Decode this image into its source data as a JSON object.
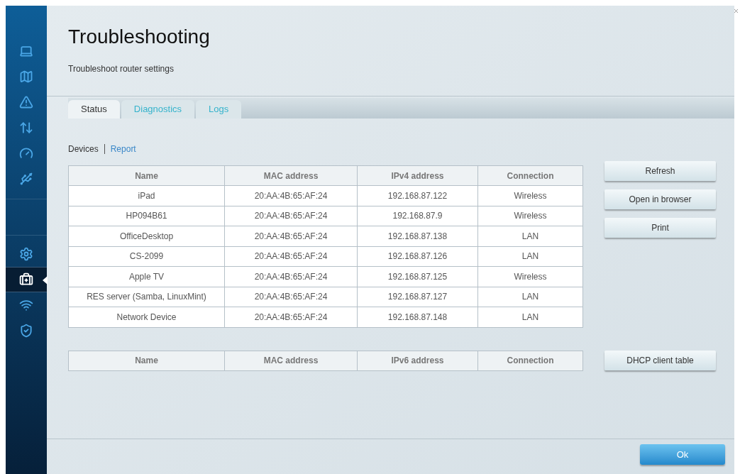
{
  "sidebar": {
    "apps": [
      {
        "selected": false
      },
      {
        "selected": false
      },
      {
        "selected": false
      },
      {
        "selected": false
      },
      {
        "selected": false
      },
      {
        "selected": false
      }
    ],
    "settings": [
      {
        "selected": false
      },
      {
        "selected": true
      },
      {
        "selected": false
      },
      {
        "selected": false
      }
    ]
  },
  "header": {
    "title": "Troubleshooting",
    "subtitle": "Troubleshoot router settings"
  },
  "tabs": [
    {
      "label": "Status",
      "selected": true
    },
    {
      "label": "Diagnostics",
      "selected": false
    },
    {
      "label": "Logs",
      "selected": false
    }
  ],
  "subnav": [
    {
      "label": "Devices",
      "selected": true
    },
    {
      "label": "Report",
      "selected": false
    }
  ],
  "ipv4_table": {
    "columns": [
      "Name",
      "MAC address",
      "IPv4 address",
      "Connection"
    ],
    "rows": [
      [
        "iPad",
        "20:AA:4B:65:AF:24",
        "192.168.87.122",
        "Wireless"
      ],
      [
        "HP094B61",
        "20:AA:4B:65:AF:24",
        "192.168.87.9",
        "Wireless"
      ],
      [
        "OfficeDesktop",
        "20:AA:4B:65:AF:24",
        "192.168.87.138",
        "LAN"
      ],
      [
        "CS-2099",
        "20:AA:4B:65:AF:24",
        "192.168.87.126",
        "LAN"
      ],
      [
        "Apple TV",
        "20:AA:4B:65:AF:24",
        "192.168.87.125",
        "Wireless"
      ],
      [
        "RES server (Samba, LinuxMint)",
        "20:AA:4B:65:AF:24",
        "192.168.87.127",
        "LAN"
      ],
      [
        "Network Device",
        "20:AA:4B:65:AF:24",
        "192.168.87.148",
        "LAN"
      ]
    ]
  },
  "ipv4_buttons": [
    "Refresh",
    "Open in browser",
    "Print"
  ],
  "ipv6_table": {
    "columns": [
      "Name",
      "MAC address",
      "IPv6 address",
      "Connection"
    ]
  },
  "ipv6_buttons": [
    "DHCP client table"
  ],
  "footer": {
    "ok_button": "Ok"
  }
}
